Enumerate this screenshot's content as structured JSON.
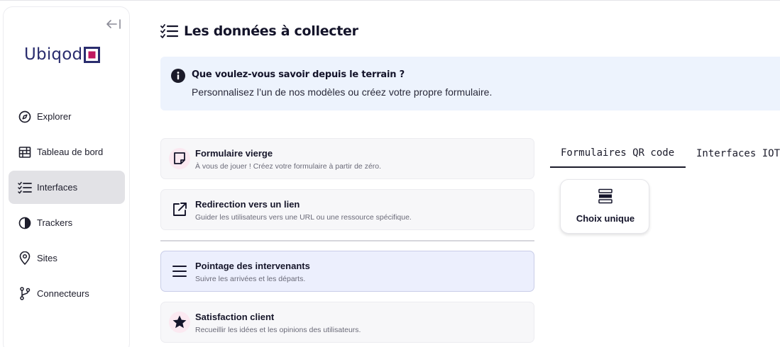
{
  "app": {
    "logo_text": "Ubiqod",
    "brand_color": "#2a2d6e",
    "accent_color": "#c0185f"
  },
  "sidebar": {
    "collapse_icon": "collapse-left-icon",
    "items": [
      {
        "label": "Explorer",
        "icon": "compass-icon",
        "active": false
      },
      {
        "label": "Tableau de bord",
        "icon": "dashboard-icon",
        "active": false
      },
      {
        "label": "Interfaces",
        "icon": "checklist-icon",
        "active": true
      },
      {
        "label": "Trackers",
        "icon": "half-circle-icon",
        "active": false
      },
      {
        "label": "Sites",
        "icon": "map-pin-icon",
        "active": false
      },
      {
        "label": "Connecteurs",
        "icon": "git-branch-icon",
        "active": false
      }
    ]
  },
  "main": {
    "title": "Les données à collecter",
    "info": {
      "title": "Que voulez-vous savoir depuis le terrain ?",
      "text": "Personnalisez l’un de nos modèles ou créez votre propre formulaire."
    },
    "templates": [
      {
        "title": "Formulaire vierge",
        "description": "À vous de jouer ! Créez votre formulaire à partir de zéro.",
        "icon": "sticky-note-icon",
        "selected": false
      },
      {
        "title": "Redirection vers un lien",
        "description": "Guider les utilisateurs vers une URL ou une ressource spécifique.",
        "icon": "external-link-icon",
        "selected": false
      },
      {
        "title": "Pointage des intervenants",
        "description": "Suivre les arrivées et les départs.",
        "icon": "menu-lines-icon",
        "selected": true
      },
      {
        "title": "Satisfaction client",
        "description": "Recueillir les idées et les opinions des utilisateurs.",
        "icon": "star-icon",
        "selected": false
      }
    ],
    "tabs": [
      {
        "label": "Formulaires QR code",
        "active": true
      },
      {
        "label": "Interfaces IOT",
        "active": false
      }
    ],
    "choice": {
      "label": "Choix unique",
      "icon": "stacked-list-icon"
    }
  }
}
